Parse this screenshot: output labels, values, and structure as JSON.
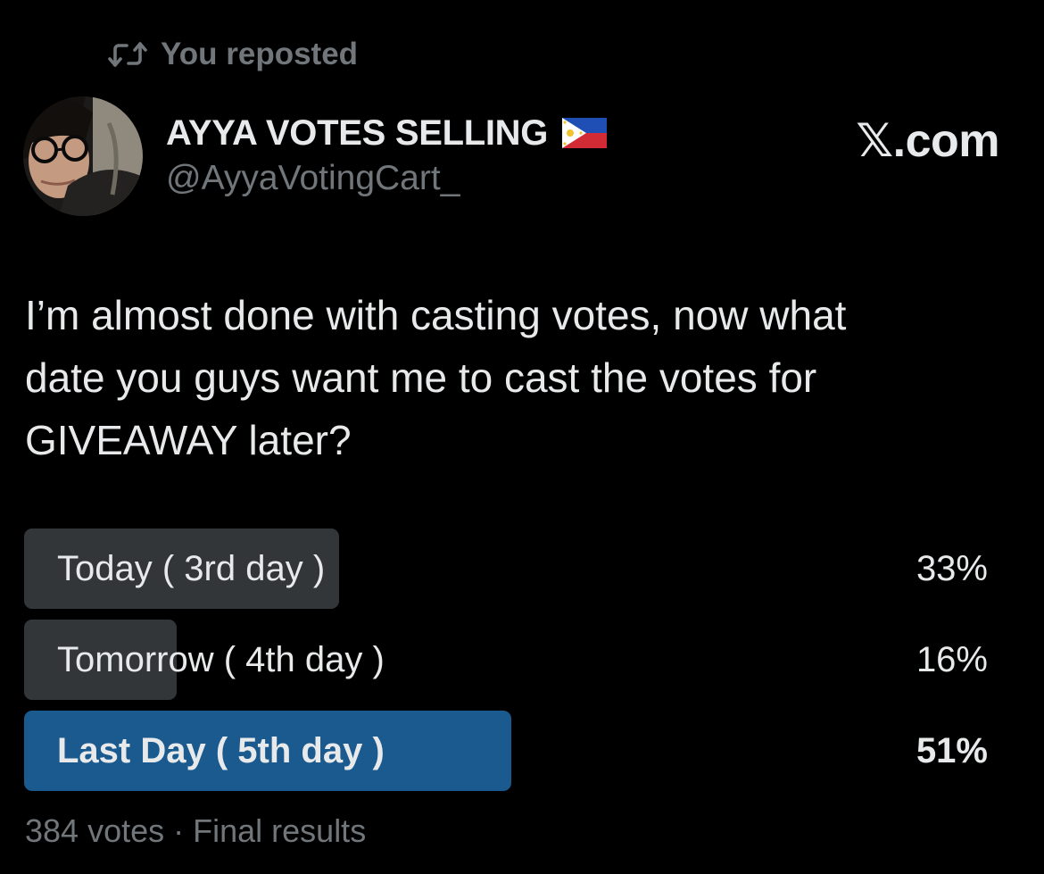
{
  "repost": {
    "icon": "repost-icon",
    "text": "You reposted"
  },
  "author": {
    "display_name": "AYYA VOTES SELLING",
    "flag": "philippines-flag-icon",
    "handle": "@AyyaVotingCart_"
  },
  "brand": "𝕏.com",
  "tweet": {
    "lines": [
      "I’m almost done with casting votes, now what",
      "date you guys want me to cast the votes for",
      "GIVEAWAY later?"
    ]
  },
  "poll": {
    "options": [
      {
        "label": "Today ( 3rd day )",
        "percent_text": "33%",
        "percent": 33,
        "winner": false
      },
      {
        "label": "Tomorrow ( 4th day )",
        "percent_text": "16%",
        "percent": 16,
        "winner": false
      },
      {
        "label": "Last Day ( 5th day )",
        "percent_text": "51%",
        "percent": 51,
        "winner": true
      }
    ],
    "votes": "384 votes",
    "separator": " · ",
    "status": "Final results"
  },
  "colors": {
    "background": "#000000",
    "text": "#e7e9ea",
    "secondary_text": "#71767b",
    "poll_bar": "#333639",
    "poll_winner_bar": "#1a5a8e"
  }
}
